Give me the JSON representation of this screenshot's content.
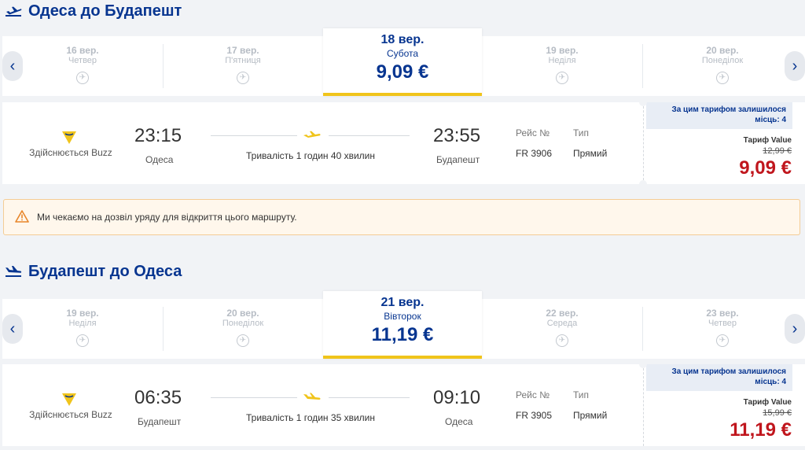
{
  "colors": {
    "brand_blue": "#073590",
    "accent_yellow": "#f0c41b",
    "price_red": "#c0161d",
    "warning_bg": "#fff7ec",
    "warning_border": "#f4cc95"
  },
  "outbound": {
    "heading": "Одеса до Будапешт",
    "dates": [
      {
        "date": "16 вер.",
        "weekday": "Четвер"
      },
      {
        "date": "17 вер.",
        "weekday": "П'ятниця"
      },
      {
        "date": "18 вер.",
        "weekday": "Субота",
        "price": "9,09 €"
      },
      {
        "date": "19 вер.",
        "weekday": "Неділя"
      },
      {
        "date": "20 вер.",
        "weekday": "Понеділок"
      }
    ],
    "flight": {
      "operated_by": "Здійснюється Buzz",
      "depart_time": "23:15",
      "depart_city": "Одеса",
      "duration": "Тривалість 1 годин 40 хвилин",
      "arrive_time": "23:55",
      "arrive_city": "Будапешт",
      "flight_label": "Рейс №",
      "flight_no": "FR 3906",
      "type_label": "Тип",
      "type_value": "Прямий",
      "seats_left": "За цим тарифом залишилося місць: 4",
      "fare_name": "Тариф Value",
      "old_price": "12,99 €",
      "price": "9,09 €"
    }
  },
  "notice": {
    "icon": "warning-icon",
    "text": "Ми чекаємо на дозвіл уряду для відкриття цього маршруту."
  },
  "inbound": {
    "heading": "Будапешт до Одеса",
    "dates": [
      {
        "date": "19 вер.",
        "weekday": "Неділя"
      },
      {
        "date": "20 вер.",
        "weekday": "Понеділок"
      },
      {
        "date": "21 вер.",
        "weekday": "Вівторок",
        "price": "11,19 €"
      },
      {
        "date": "22 вер.",
        "weekday": "Середа"
      },
      {
        "date": "23 вер.",
        "weekday": "Четвер"
      }
    ],
    "flight": {
      "operated_by": "Здійснюється Buzz",
      "depart_time": "06:35",
      "depart_city": "Будапешт",
      "duration": "Тривалість 1 годин 35 хвилин",
      "arrive_time": "09:10",
      "arrive_city": "Одеса",
      "flight_label": "Рейс №",
      "flight_no": "FR 3905",
      "type_label": "Тип",
      "type_value": "Прямий",
      "seats_left": "За цим тарифом залишилося місць: 4",
      "fare_name": "Тариф Value",
      "old_price": "15,99 €",
      "price": "11,19 €"
    }
  }
}
